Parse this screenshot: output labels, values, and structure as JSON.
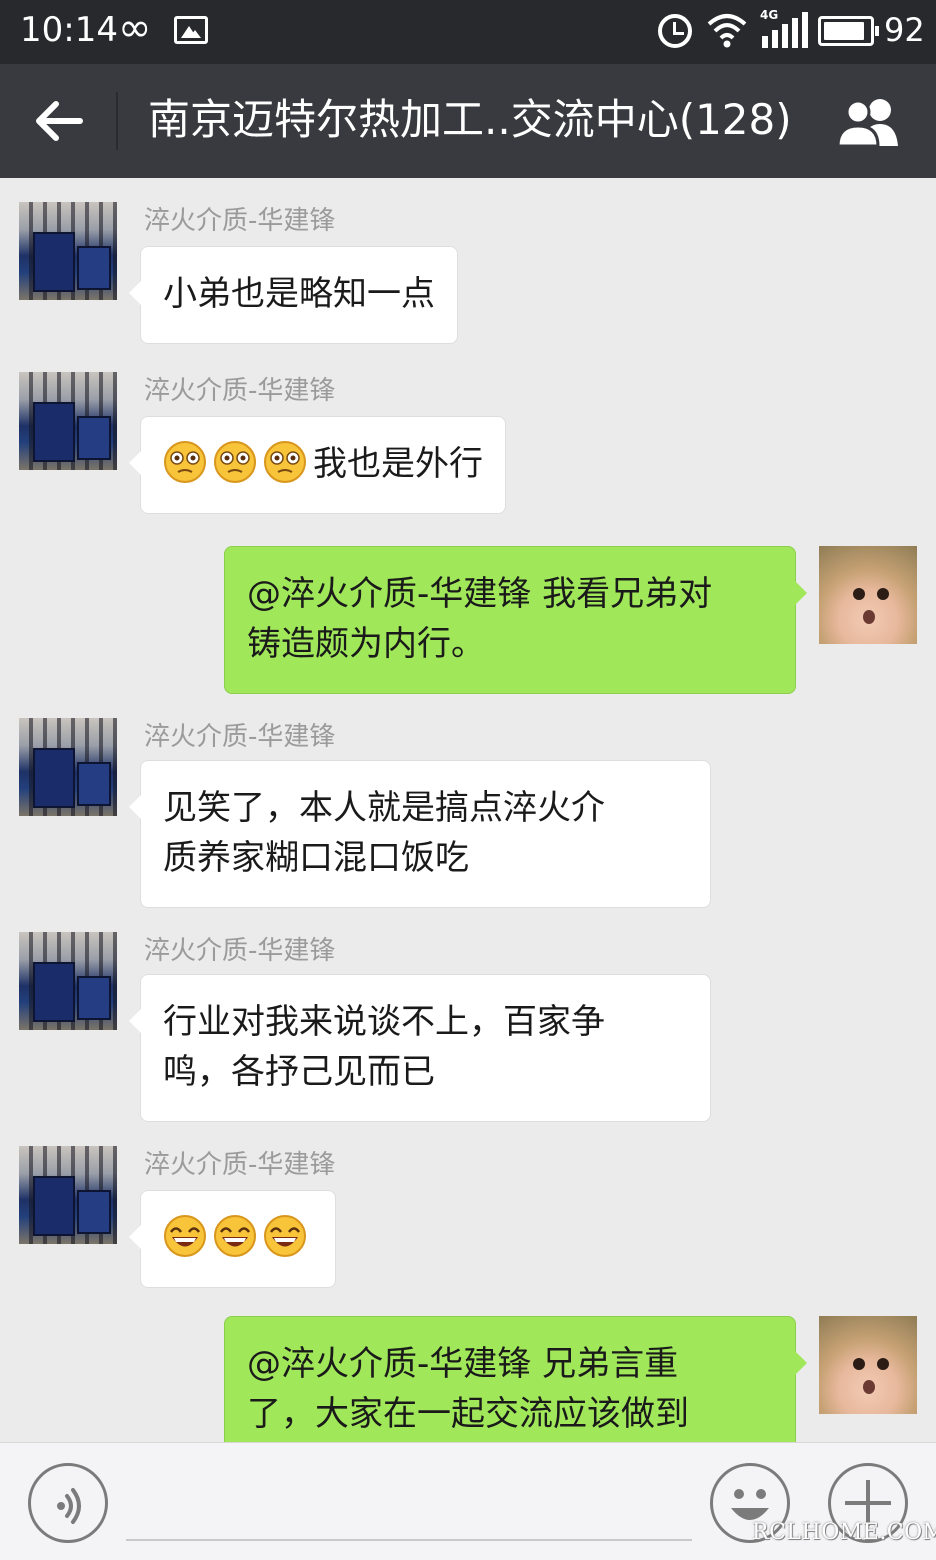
{
  "status_bar": {
    "time": "10:14",
    "infinity_symbol": "∞",
    "network_type": "4G",
    "battery_level_percent": 92,
    "battery_text": "92",
    "icons": [
      "infinity-icon",
      "gallery-icon",
      "alarm-icon",
      "wifi-icon",
      "signal-icon",
      "battery-icon"
    ]
  },
  "header": {
    "title": "南京迈特尔热加工..交流中心(128)",
    "back_icon": "arrow-left-icon",
    "group_icon": "group-members-icon"
  },
  "messages": [
    {
      "direction": "in",
      "sender": "淬火介质-华建锋",
      "text": "小弟也是略知一点",
      "emoji_count": 0
    },
    {
      "direction": "in",
      "sender": "淬火介质-华建锋",
      "text": "我也是外行",
      "emoji_name": "dazed-face-emoji",
      "emoji_count": 3
    },
    {
      "direction": "out",
      "text": "@淬火介质-华建锋 我看兄弟对\n铸造颇为内行。"
    },
    {
      "direction": "in",
      "sender": "淬火介质-华建锋",
      "text": "见笑了，本人就是搞点淬火介\n质养家糊口混口饭吃"
    },
    {
      "direction": "in",
      "sender": "淬火介质-华建锋",
      "text": "行业对我来说谈不上，百家争\n鸣，各抒己见而已"
    },
    {
      "direction": "in",
      "sender": "淬火介质-华建锋",
      "text": "",
      "emoji_name": "grinning-face-emoji",
      "emoji_count": 3
    },
    {
      "direction": "out",
      "text": "@淬火介质-华建锋 兄弟言重\n了，大家在一起交流应该做到"
    }
  ],
  "input_bar": {
    "voice_icon": "voice-icon",
    "emoji_icon": "emoji-icon",
    "plus_icon": "plus-icon"
  },
  "watermark": "RCLHOME.COM",
  "colors": {
    "status_bar": "#27292d",
    "header": "#393a3f",
    "chat_background": "#ebebeb",
    "outgoing_bubble": "#a0e75a",
    "incoming_bubble": "#ffffff"
  }
}
